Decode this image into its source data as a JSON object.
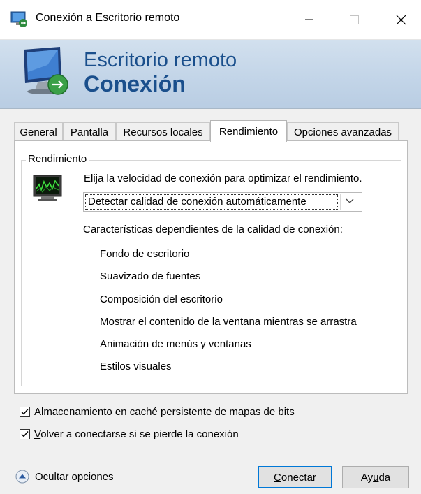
{
  "window": {
    "title": "Conexión a Escritorio remoto"
  },
  "banner": {
    "line1": "Escritorio remoto",
    "line2": "Conexión"
  },
  "tabs": [
    {
      "label": "General",
      "active": false
    },
    {
      "label": "Pantalla",
      "active": false
    },
    {
      "label": "Recursos locales",
      "active": false
    },
    {
      "label": "Rendimiento",
      "active": true
    },
    {
      "label": "Opciones avanzadas",
      "active": false
    }
  ],
  "performance": {
    "group_label": "Rendimiento",
    "prompt": "Elija la velocidad de conexión para optimizar el rendimiento.",
    "connection_select": {
      "selected": "Detectar calidad de conexión automáticamente"
    },
    "features_heading": "Características dependientes de la calidad de conexión:",
    "features": [
      "Fondo de escritorio",
      "Suavizado de fuentes",
      "Composición del escritorio",
      "Mostrar el contenido de la ventana mientras se arrastra",
      "Animación de menús y ventanas",
      "Estilos visuales"
    ]
  },
  "options": {
    "bitmap_cache": {
      "label_before": "Almacenamiento en caché persistente de mapas de ",
      "label_ul": "b",
      "label_after": "its",
      "checked": true
    },
    "reconnect": {
      "label_ul": "V",
      "label_after": "olver a conectarse si se pierde la conexión",
      "checked": true
    }
  },
  "footer": {
    "hide_options": {
      "before": "Ocultar ",
      "ul": "o",
      "after": "pciones"
    },
    "connect": {
      "ul": "C",
      "after": "onectar"
    },
    "help": {
      "before": "Ay",
      "ul": "u",
      "after": "da"
    }
  },
  "colors": {
    "banner_text": "#1a4f8c",
    "focus_border": "#0078d7"
  }
}
